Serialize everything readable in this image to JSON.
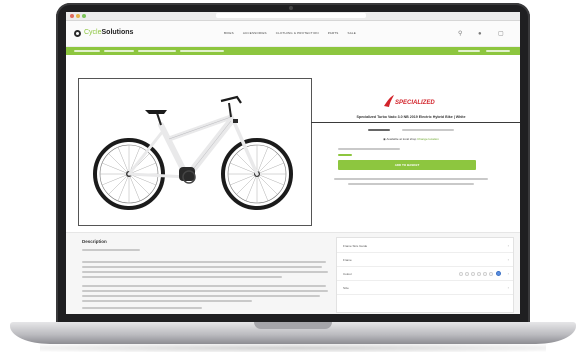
{
  "site": {
    "logo_prefix": "Cycle",
    "logo_name": "Solutions"
  },
  "nav": {
    "items": [
      "BIKES",
      "ACCESSORIES",
      "CLOTHING & PROTECTION",
      "PARTS",
      "SALE"
    ]
  },
  "product": {
    "brand": "SPECIALIZED",
    "title": "Specialized Turbo Vado 3.0 NB 2019 Electric Hybrid Bike | White",
    "stock_label": "Available at local shop",
    "stock_link": "Change location",
    "add_to_cart": "ADD TO BASKET"
  },
  "description": {
    "title": "Description"
  },
  "specs": {
    "rows": [
      {
        "label": "Frame Size Guide"
      },
      {
        "label": "Frame"
      },
      {
        "label": "Colour"
      },
      {
        "label": "Size"
      }
    ]
  },
  "colors": {
    "accent": "#8dc63f",
    "brand_red": "#d2232a",
    "frame": "#1f1f21"
  }
}
